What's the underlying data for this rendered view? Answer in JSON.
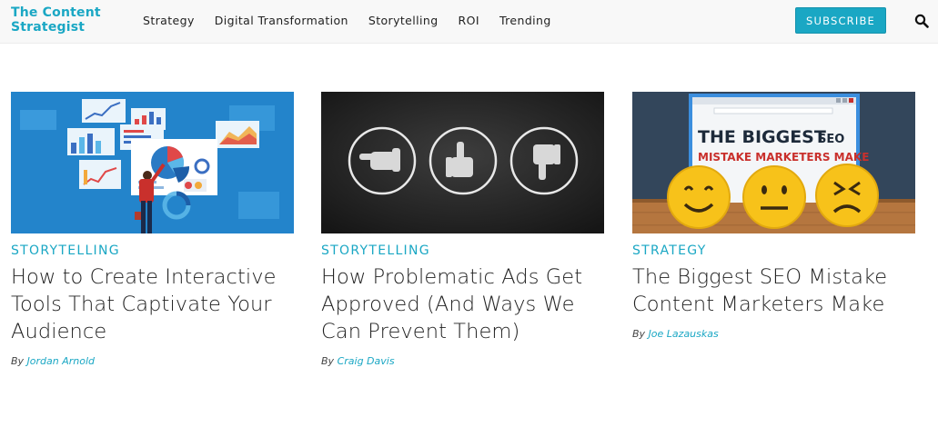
{
  "header": {
    "logo_line1": "The Content",
    "logo_line2": "Strategist",
    "nav": [
      "Strategy",
      "Digital Transformation",
      "Storytelling",
      "ROI",
      "Trending"
    ],
    "subscribe_label": "SUBSCRIBE",
    "search_icon": "search-icon"
  },
  "colors": {
    "accent": "#1aa7c4",
    "text": "#222222",
    "header_bg": "#f8f8f8"
  },
  "articles": [
    {
      "category": "STORYTELLING",
      "title": "How to Create Interactive Tools That Captivate Your Audience",
      "by": "By",
      "author": "Jordan Arnold"
    },
    {
      "category": "STORYTELLING",
      "title": "How Problematic Ads Get Approved (And Ways We Can Prevent Them)",
      "by": "By",
      "author": "Craig Davis"
    },
    {
      "category": "STRATEGY",
      "title": "The Biggest SEO Mistake Content Marketers Make",
      "by": "By",
      "author": "Joe Lazauskas",
      "image_text_line1": "THE BIGGEST",
      "image_text_seo": "SEO",
      "image_text_line2": "MISTAKE MARKETERS MAKE"
    }
  ]
}
